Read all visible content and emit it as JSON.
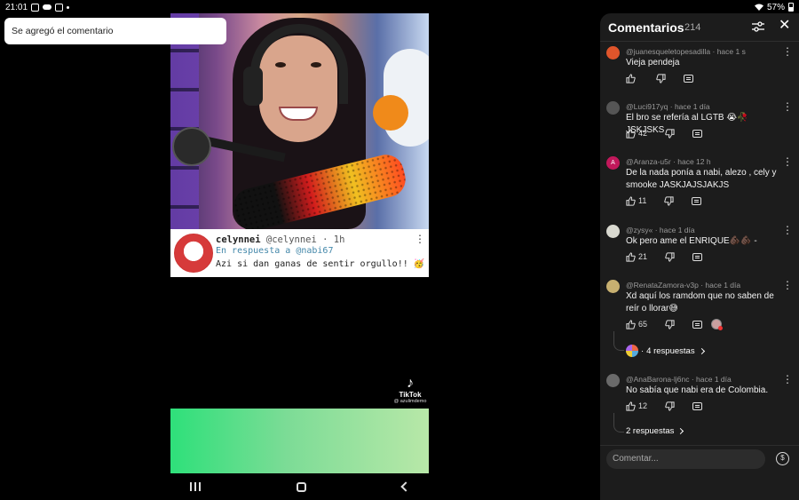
{
  "status_bar": {
    "time": "21:01",
    "battery": "57%"
  },
  "toast": {
    "text": "Se agregó el comentario"
  },
  "reply_card": {
    "display_name": "celynnei",
    "handle": "@celynnei",
    "time": "· 1h",
    "reply_prefix": "En respuesta a",
    "reply_to": "@nabi67",
    "text": "Azi si dan ganas de sentir orgullo!! 🥳"
  },
  "tiktok": {
    "name": "TikTok",
    "handle": "@ azulimdemo"
  },
  "comments_panel": {
    "title": "Comentarios",
    "count": "214",
    "input_placeholder": "Comentar...",
    "comments": [
      {
        "user": "@juanesqueletopesadilla",
        "time": "hace 1 s",
        "text": "Vieja pendeja",
        "likes": "",
        "avatar_color": "#e0552b",
        "avatar_letter": ""
      },
      {
        "user": "@Luci917yq",
        "time": "hace 1 día",
        "text": "El bro se refería al LGTB 😭🥀 JSKJSKS",
        "likes": "42",
        "avatar_color": "#555555",
        "avatar_letter": ""
      },
      {
        "user": "@Aranza-u5r",
        "time": "hace 12 h",
        "text": "De la nada ponía a nabi, alezo , cely y smooke JASKJAJSJAKJS",
        "likes": "11",
        "avatar_color": "#c2185b",
        "avatar_letter": "A"
      },
      {
        "user": "@zysy«",
        "time": "hace 1 día",
        "text": "Ok pero ame el ENRIQUE🫵🏿🫵🏿 -",
        "likes": "21",
        "avatar_color": "#d9d9d0",
        "avatar_letter": ""
      },
      {
        "user": "@RenataZamora-v3p",
        "time": "hace 1 día",
        "text": "Xd aquí los ramdom que no saben de reír o llorar😅",
        "likes": "65",
        "avatar_color": "#c8b070",
        "avatar_letter": "",
        "replies": "4 respuestas"
      },
      {
        "user": "@AnaBarona-lj6nc",
        "time": "hace 1 día",
        "text": "No sabía que nabi era de Colombia.",
        "likes": "12",
        "avatar_color": "#6a6a6a",
        "avatar_letter": "",
        "replies": "2 respuestas"
      }
    ]
  },
  "icons": {
    "status": [
      "instagram-icon",
      "cloud-icon",
      "instagram-icon",
      "dot-icon",
      "wifi-icon",
      "battery-icon"
    ],
    "header": [
      "filter-icon",
      "close-icon"
    ],
    "actions": [
      "thumbs-up-icon",
      "thumbs-down-icon",
      "reply-icon",
      "more-vertical-icon"
    ],
    "nav": [
      "recent-apps-icon",
      "home-icon",
      "back-icon"
    ],
    "input": [
      "tip-coin-icon"
    ]
  }
}
